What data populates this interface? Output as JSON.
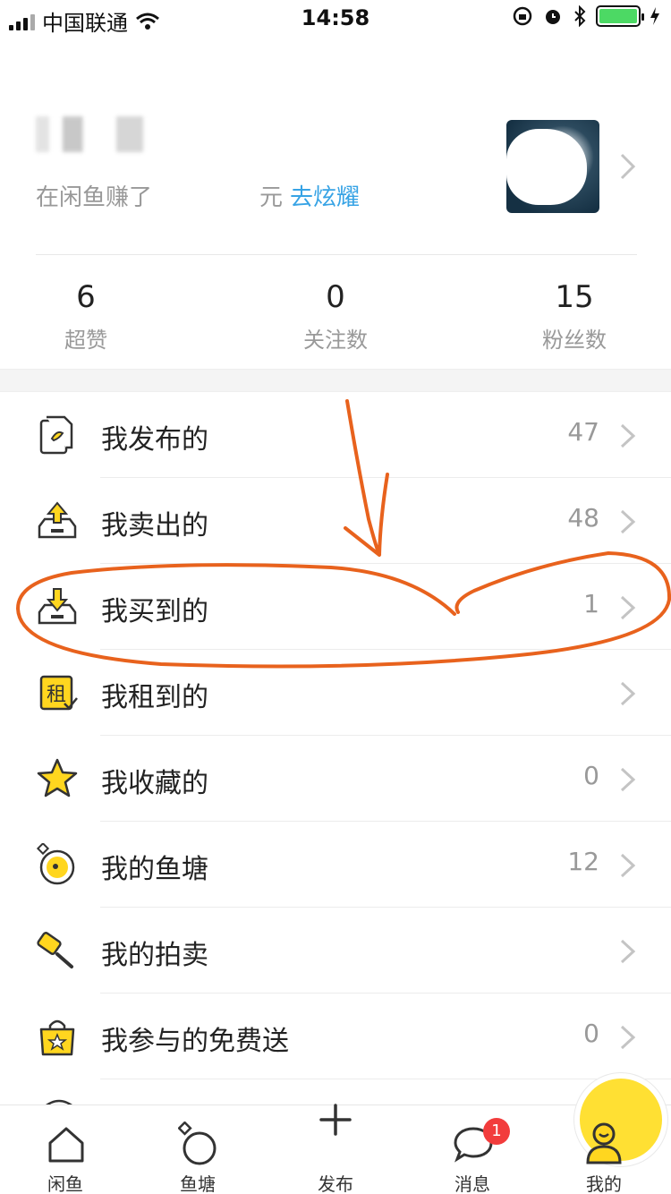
{
  "status_bar": {
    "carrier": "中国联通",
    "time": "14:58"
  },
  "profile": {
    "earn_prefix": "在闲鱼赚了",
    "earn_suffix": "元",
    "earn_link": "去炫耀"
  },
  "stats": [
    {
      "value": "6",
      "label": "超赞"
    },
    {
      "value": "0",
      "label": "关注数"
    },
    {
      "value": "15",
      "label": "粉丝数"
    }
  ],
  "menu": [
    {
      "label": "我发布的",
      "count": "47",
      "icon": "published-doc-icon"
    },
    {
      "label": "我卖出的",
      "count": "48",
      "icon": "sold-box-icon"
    },
    {
      "label": "我买到的",
      "count": "1",
      "icon": "bought-box-icon"
    },
    {
      "label": "我租到的",
      "count": "",
      "icon": "rent-icon",
      "icon_char": "租"
    },
    {
      "label": "我收藏的",
      "count": "0",
      "icon": "star-icon"
    },
    {
      "label": "我的鱼塘",
      "count": "12",
      "icon": "fishpond-icon"
    },
    {
      "label": "我的拍卖",
      "count": "",
      "icon": "auction-hammer-icon"
    },
    {
      "label": "我参与的免费送",
      "count": "0",
      "icon": "gift-bag-icon"
    }
  ],
  "tabbar": {
    "tabs": [
      "闲鱼",
      "鱼塘",
      "发布",
      "消息",
      "我的"
    ],
    "message_badge": "1"
  },
  "colors": {
    "accent_yellow": "#ffe033",
    "link_blue": "#37a3e5",
    "annotation_orange": "#e8621d",
    "badge_red": "#f23c3c"
  }
}
